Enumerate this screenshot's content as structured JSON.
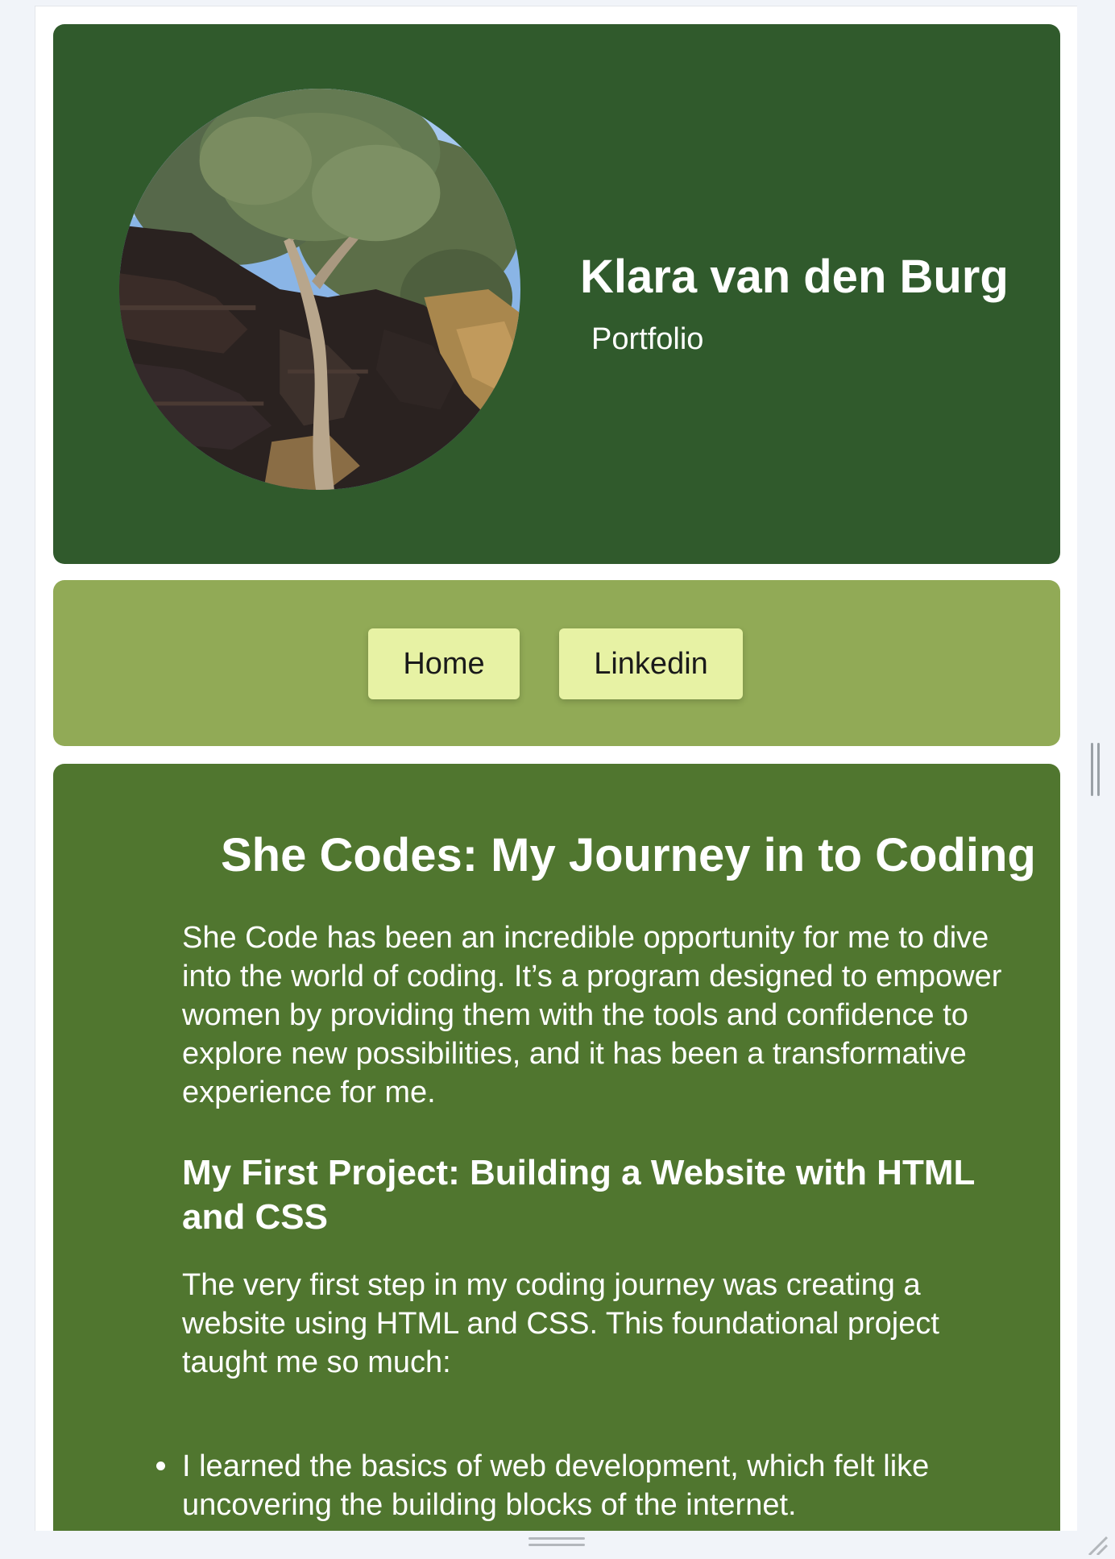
{
  "header": {
    "name": "Klara van den Burg",
    "subtitle": "Portfolio",
    "background_color": "#305a2c"
  },
  "profile_image": {
    "alt": "Tree growing on a rocky cliff against a blue sky"
  },
  "nav": {
    "background_color": "#91aa56",
    "button_color": "#e7f2a4",
    "items": [
      {
        "label": "Home"
      },
      {
        "label": "Linkedin"
      }
    ]
  },
  "content": {
    "background_color": "#50762f",
    "title": "She Codes: My Journey in to Coding",
    "intro": "She Code has been an incredible opportunity for me to dive into the world of coding. It’s a program designed to empower women by providing them with the tools and confidence to explore new possibilities, and it has been a transformative experience for me.",
    "project_heading": "My First Project: Building a Website with HTML and CSS",
    "project_text": "The very first step in my coding journey was creating a website using HTML and CSS. This foundational project taught me so much:",
    "list": [
      "I learned the basics of web development, which felt like uncovering the building blocks of the internet."
    ]
  }
}
